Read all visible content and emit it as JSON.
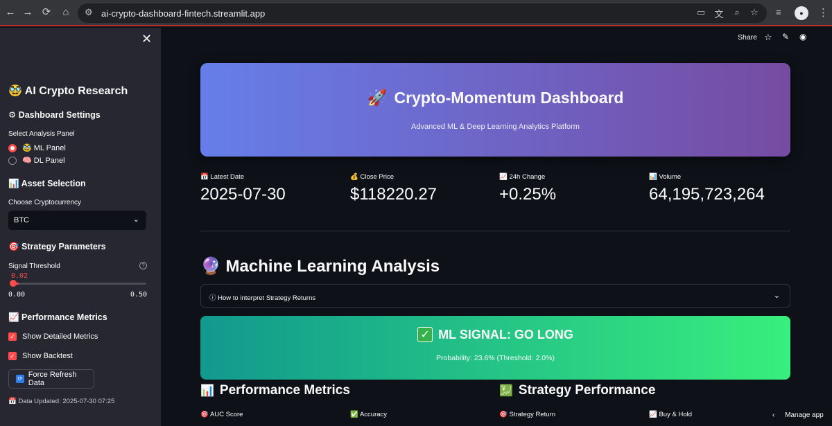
{
  "browser": {
    "back": "←",
    "forward": "→",
    "reload": "⟳",
    "home": "⌂",
    "url": "ai-crypto-dashboard-fintech.streamlit.app"
  },
  "sidebar": {
    "close": "✕",
    "app_title": "🥸 AI Crypto Research",
    "settings_header": "⚙ Dashboard Settings",
    "panel_label": "Select Analysis Panel",
    "panels": [
      {
        "label": "🥸 ML Panel",
        "selected": true
      },
      {
        "label": "🧠 DL Panel",
        "selected": false
      }
    ],
    "asset_header": "📊 Asset Selection",
    "crypto_label": "Choose Cryptocurrency",
    "crypto_value": "BTC",
    "strategy_header": "🎯 Strategy Parameters",
    "threshold_label": "Signal Threshold",
    "threshold_value": "0.02",
    "threshold_min": "0.00",
    "threshold_max": "0.50",
    "threshold_fraction": 0.04,
    "perf_header": "📈 Performance Metrics",
    "checks": [
      {
        "label": "Show Detailed Metrics",
        "checked": true
      },
      {
        "label": "Show Backtest",
        "checked": true
      }
    ],
    "refresh_label": "Force Refresh Data",
    "footer": "📅 Data Updated: 2025-07-30 07:25"
  },
  "topbar": {
    "share": "Share"
  },
  "hero": {
    "title": "Crypto-Momentum Dashboard",
    "emoji": "🚀",
    "subtitle": "Advanced ML & Deep Learning Analytics Platform"
  },
  "metrics": [
    {
      "label": "📅 Latest Date",
      "value": "2025-07-30"
    },
    {
      "label": "💰 Close Price",
      "value": "$118220.27"
    },
    {
      "label": "📈 24h Change",
      "value": "+0.25%"
    },
    {
      "label": "📊 Volume",
      "value": "64,195,723,264"
    }
  ],
  "ml_section": {
    "title": "🔮 Machine Learning Analysis",
    "expander": "ⓘ How to interpret Strategy Returns",
    "signal_title": "ML SIGNAL: GO LONG",
    "signal_sub": "Probability: 23.6% (Threshold: 2.0%)"
  },
  "perf": {
    "left_title": "Performance Metrics",
    "left_icon": "📊",
    "right_title": "Strategy Performance",
    "right_icon": "💹",
    "cards": [
      "🎯 AUC Score",
      "✅ Accuracy",
      "🎯 Strategy Return",
      "📈 Buy & Hold"
    ]
  },
  "manage_app": "Manage app"
}
